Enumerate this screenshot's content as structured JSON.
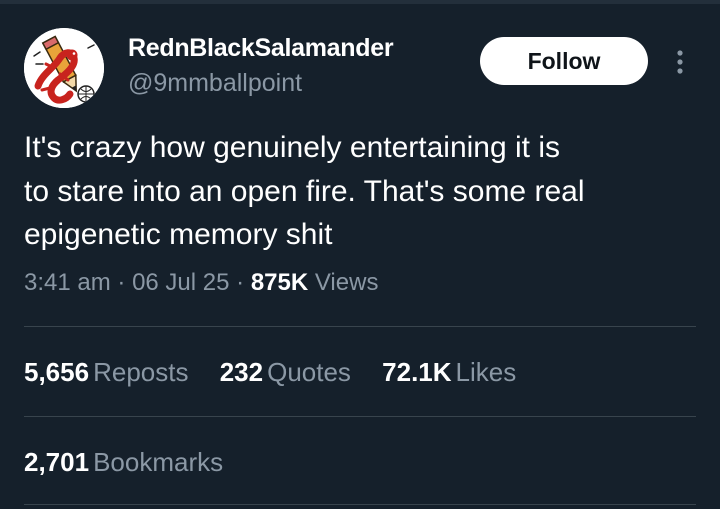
{
  "user": {
    "display_name": "RednBlackSalamander",
    "handle": "@9mmballpoint",
    "avatar_icon": "salamander-pencil-avatar-icon"
  },
  "follow_button": {
    "label": "Follow"
  },
  "more_icon": "more-options-vertical-dots-icon",
  "tweet": {
    "text": "It's crazy how genuinely entertaining it is\nto stare into an open fire. That's some real\nepigenetic memory shit",
    "time": "3:41 am",
    "date": "06 Jul 25",
    "separator": "·",
    "views_count": "875K",
    "views_label": "Views"
  },
  "stats": {
    "reposts": {
      "count": "5,656",
      "label": "Reposts"
    },
    "quotes": {
      "count": "232",
      "label": "Quotes"
    },
    "likes": {
      "count": "72.1K",
      "label": "Likes"
    },
    "bookmarks": {
      "count": "2,701",
      "label": "Bookmarks"
    }
  },
  "colors": {
    "background": "#15202b",
    "secondary_text": "#8b98a5",
    "divider": "#38444d",
    "salamander_red": "#c8231e"
  }
}
